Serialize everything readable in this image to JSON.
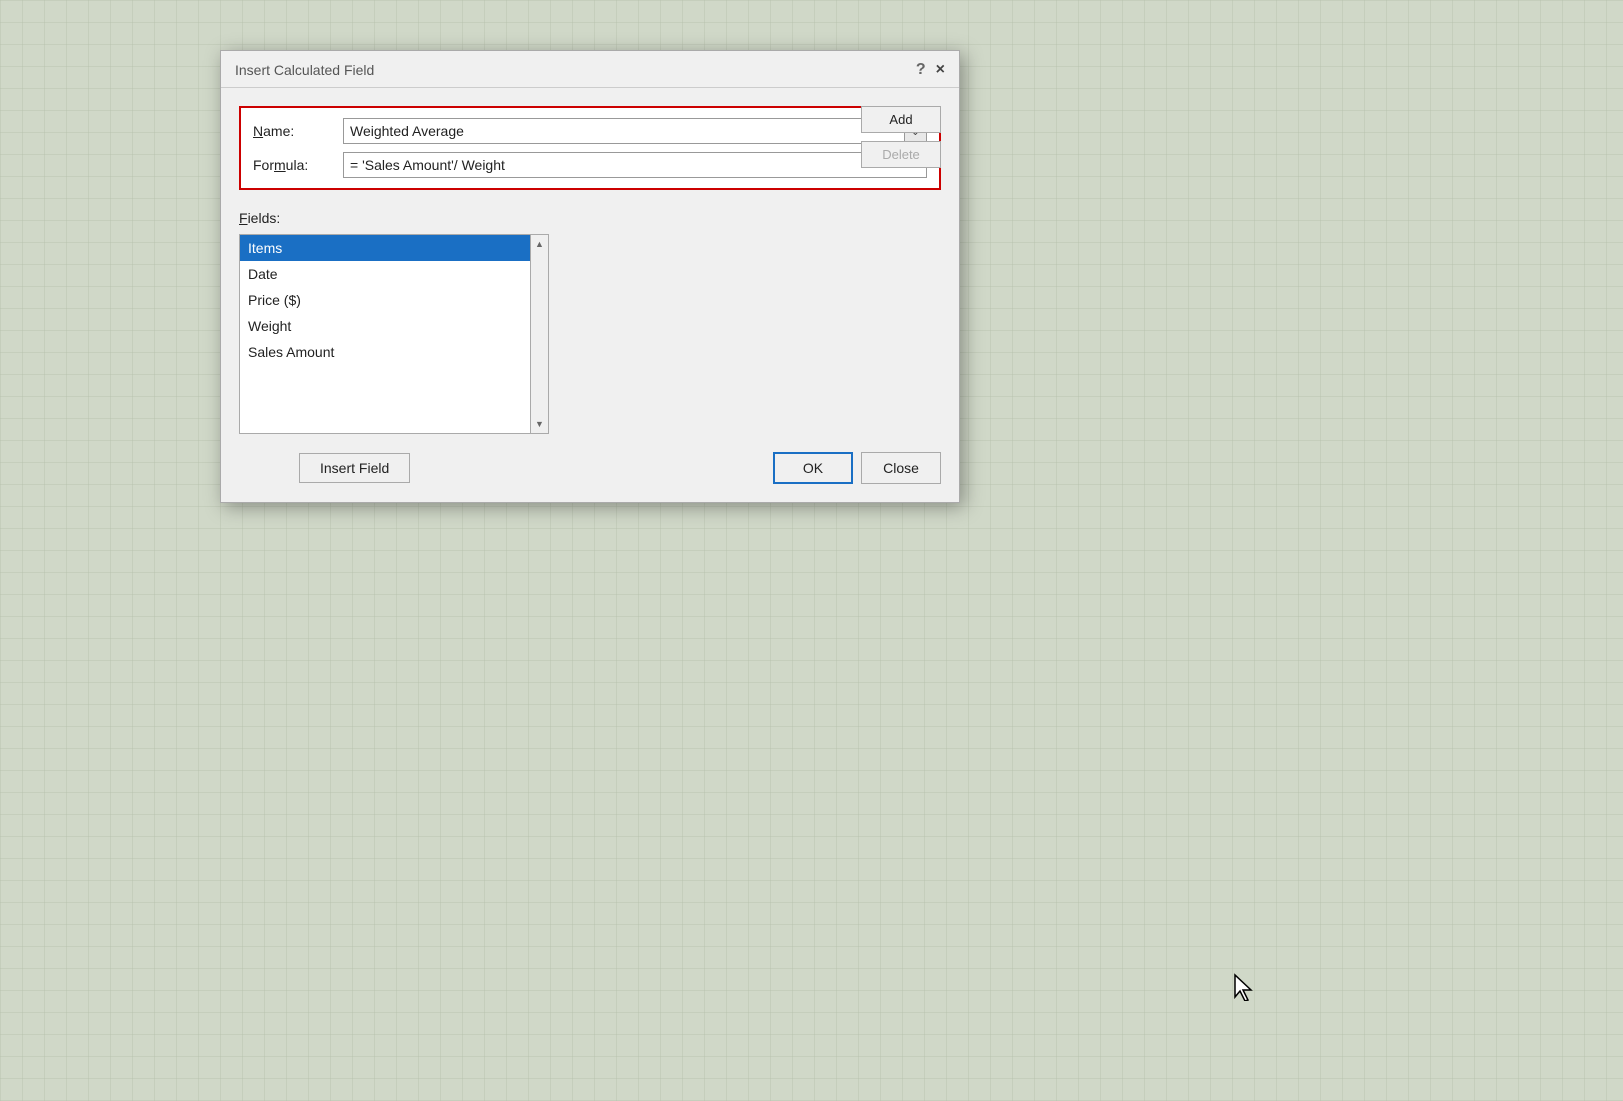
{
  "dialog": {
    "title": "Insert Calculated Field",
    "help_label": "?",
    "close_label": "×"
  },
  "name_section": {
    "name_label": "Name:",
    "name_label_underline": "N",
    "name_value": "Weighted Average",
    "formula_label": "Formula:",
    "formula_label_underline": "m",
    "formula_value": "= 'Sales Amount'/ Weight"
  },
  "buttons": {
    "add_label": "Add",
    "delete_label": "Delete"
  },
  "fields_section": {
    "fields_label": "Fields:",
    "fields_label_underline": "F",
    "fields": [
      {
        "label": "Items",
        "selected": true
      },
      {
        "label": "Date",
        "selected": false
      },
      {
        "label": "Price ($)",
        "selected": false
      },
      {
        "label": "Weight",
        "selected": false
      },
      {
        "label": "Sales Amount",
        "selected": false
      }
    ]
  },
  "insert_field_btn": "Insert Field",
  "ok_btn": "OK",
  "close_btn": "Close"
}
